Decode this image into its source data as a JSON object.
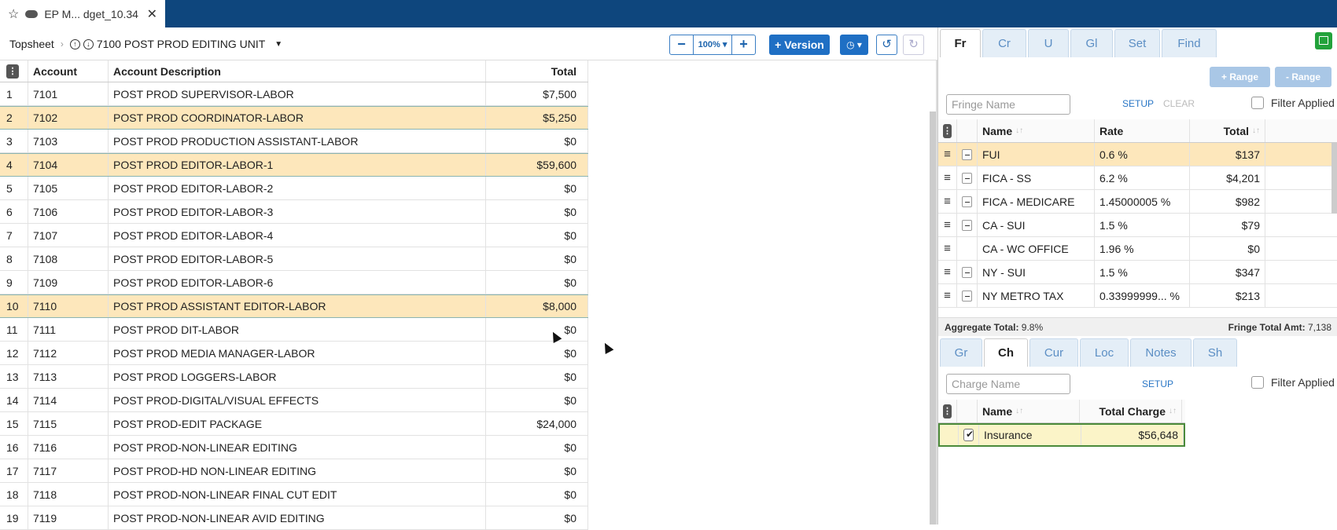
{
  "tab": {
    "title": "EP M... dget_10.34"
  },
  "toolbar": {
    "breadcrumb_root": "Topsheet",
    "breadcrumb_current": "7100 POST PROD EDITING UNIT",
    "zoom": "100%",
    "version_label": "+ Version"
  },
  "grid": {
    "headers": {
      "account": "Account",
      "description": "Account Description",
      "total": "Total"
    },
    "rows": [
      {
        "n": "1",
        "account": "7101",
        "desc": "POST PROD SUPERVISOR-LABOR",
        "total": "$7,500",
        "sel": false
      },
      {
        "n": "2",
        "account": "7102",
        "desc": "POST PROD COORDINATOR-LABOR",
        "total": "$5,250",
        "sel": true
      },
      {
        "n": "3",
        "account": "7103",
        "desc": "POST PROD PRODUCTION ASSISTANT-LABOR",
        "total": "$0",
        "sel": false
      },
      {
        "n": "4",
        "account": "7104",
        "desc": "POST PROD EDITOR-LABOR-1",
        "total": "$59,600",
        "sel": true
      },
      {
        "n": "5",
        "account": "7105",
        "desc": "POST PROD EDITOR-LABOR-2",
        "total": "$0",
        "sel": false
      },
      {
        "n": "6",
        "account": "7106",
        "desc": "POST PROD EDITOR-LABOR-3",
        "total": "$0",
        "sel": false
      },
      {
        "n": "7",
        "account": "7107",
        "desc": "POST PROD EDITOR-LABOR-4",
        "total": "$0",
        "sel": false
      },
      {
        "n": "8",
        "account": "7108",
        "desc": "POST PROD EDITOR-LABOR-5",
        "total": "$0",
        "sel": false
      },
      {
        "n": "9",
        "account": "7109",
        "desc": "POST PROD EDITOR-LABOR-6",
        "total": "$0",
        "sel": false
      },
      {
        "n": "10",
        "account": "7110",
        "desc": "POST PROD ASSISTANT EDITOR-LABOR",
        "total": "$8,000",
        "sel": true
      },
      {
        "n": "11",
        "account": "7111",
        "desc": "POST PROD DIT-LABOR",
        "total": "$0",
        "sel": false
      },
      {
        "n": "12",
        "account": "7112",
        "desc": "POST PROD MEDIA MANAGER-LABOR",
        "total": "$0",
        "sel": false
      },
      {
        "n": "13",
        "account": "7113",
        "desc": "POST PROD LOGGERS-LABOR",
        "total": "$0",
        "sel": false
      },
      {
        "n": "14",
        "account": "7114",
        "desc": "POST PROD-DIGITAL/VISUAL EFFECTS",
        "total": "$0",
        "sel": false
      },
      {
        "n": "15",
        "account": "7115",
        "desc": "POST PROD-EDIT PACKAGE",
        "total": "$24,000",
        "sel": false
      },
      {
        "n": "16",
        "account": "7116",
        "desc": "POST PROD-NON-LINEAR EDITING",
        "total": "$0",
        "sel": false
      },
      {
        "n": "17",
        "account": "7117",
        "desc": "POST PROD-HD NON-LINEAR EDITING",
        "total": "$0",
        "sel": false
      },
      {
        "n": "18",
        "account": "7118",
        "desc": "POST PROD-NON-LINEAR FINAL CUT EDIT",
        "total": "$0",
        "sel": false
      },
      {
        "n": "19",
        "account": "7119",
        "desc": "POST PROD-NON-LINEAR AVID EDITING",
        "total": "$0",
        "sel": false
      }
    ]
  },
  "fringe_tabs": [
    "Fr",
    "Cr",
    "U",
    "Gl",
    "Set",
    "Find"
  ],
  "fringe": {
    "add_range": "+ Range",
    "remove_range": "- Range",
    "search_placeholder": "Fringe Name",
    "setup": "SETUP",
    "clear": "CLEAR",
    "filter_label": "Filter Applied",
    "headers": {
      "name": "Name",
      "rate": "Rate",
      "total": "Total"
    },
    "rows": [
      {
        "name": "FUI",
        "rate": "0.6 %",
        "total": "$137",
        "sel": true,
        "checkbox": "minus"
      },
      {
        "name": "FICA - SS",
        "rate": "6.2 %",
        "total": "$4,201",
        "sel": false,
        "checkbox": "minus"
      },
      {
        "name": "FICA - MEDICARE",
        "rate": "1.45000005 %",
        "total": "$982",
        "sel": false,
        "checkbox": "minus"
      },
      {
        "name": "CA - SUI",
        "rate": "1.5 %",
        "total": "$79",
        "sel": false,
        "checkbox": "minus"
      },
      {
        "name": "CA - WC OFFICE",
        "rate": "1.96 %",
        "total": "$0",
        "sel": false,
        "checkbox": "empty"
      },
      {
        "name": "NY - SUI",
        "rate": "1.5 %",
        "total": "$347",
        "sel": false,
        "checkbox": "minus"
      },
      {
        "name": "NY METRO TAX",
        "rate": "0.33999999...  %",
        "total": "$213",
        "sel": false,
        "checkbox": "minus"
      }
    ],
    "aggregate_label": "Aggregate Total:",
    "aggregate_value": "9.8%",
    "fringe_total_label": "Fringe Total Amt:",
    "fringe_total_value": "7,138"
  },
  "charge_tabs": [
    "Gr",
    "Ch",
    "Cur",
    "Loc",
    "Notes",
    "Sh"
  ],
  "charge": {
    "search_placeholder": "Charge Name",
    "setup": "SETUP",
    "filter_label": "Filter Applied",
    "headers": {
      "name": "Name",
      "total": "Total Charge"
    },
    "rows": [
      {
        "name": "Insurance",
        "total": "$56,648",
        "checked": true
      }
    ]
  },
  "colors": {
    "topbar": "#0e467d",
    "accent": "#1f6fc4",
    "highlight": "#fde7bb",
    "green": "#23a23b"
  }
}
